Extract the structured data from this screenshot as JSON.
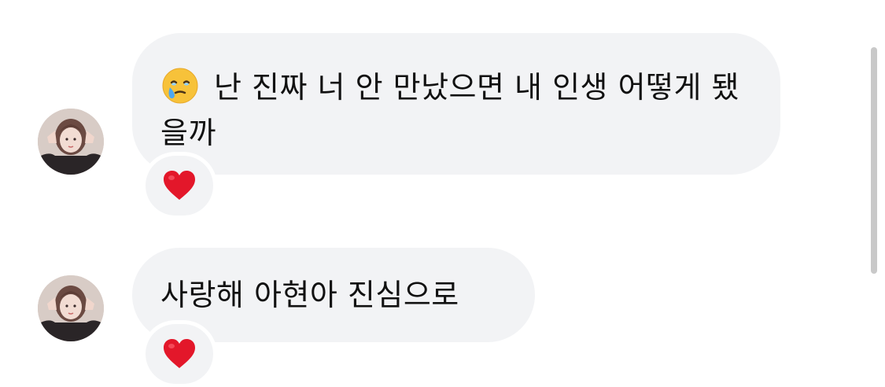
{
  "messages": [
    {
      "text": "난 진짜 너 안 만났으면 내 인생 어떻게 됐을까",
      "leading_emoji": "face-holding-back-tears",
      "reaction": "red-heart",
      "reaction_glyph": "❤️"
    },
    {
      "text": "사랑해 아현아 진심으로",
      "reaction": "red-heart",
      "reaction_glyph": "❤️"
    }
  ],
  "colors": {
    "bubble": "#f2f3f5",
    "text": "#111111",
    "heart": "#e3172a",
    "scrollbar": "#c9c9c9"
  }
}
